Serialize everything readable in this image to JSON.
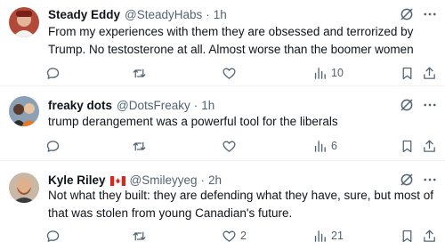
{
  "tweets": [
    {
      "name": "Steady Eddy",
      "handle": "@SteadyHabs",
      "dot": "·",
      "time": "1h",
      "flag": false,
      "text": "From my experiences with them they are obsessed and terrorized by Trump. No testosterone at all. Almost worse than the boomer women",
      "likes": "",
      "views": "10"
    },
    {
      "name": "freaky dots",
      "handle": "@DotsFreaky",
      "dot": "·",
      "time": "1h",
      "flag": false,
      "text": "trump derangement was a powerful tool for the liberals",
      "likes": "",
      "views": "6"
    },
    {
      "name": "Kyle Riley",
      "handle": "@Smileyyeg",
      "dot": "·",
      "time": "2h",
      "flag": true,
      "text": "Not what they built: they are defending what they have, sure, but most of that was stolen from young Canadian's future.",
      "likes": "2",
      "views": "21"
    }
  ],
  "icons": {
    "reply": "reply-icon",
    "retweet": "retweet-icon",
    "like": "heart-icon",
    "views": "views-icon",
    "bookmark": "bookmark-icon",
    "share": "share-icon",
    "grok": "grok-icon",
    "more": "more-icon"
  },
  "colors": {
    "text": "#0f1419",
    "secondary": "#536471",
    "separator": "#eff3f4",
    "flag_red": "#d52b1e"
  }
}
